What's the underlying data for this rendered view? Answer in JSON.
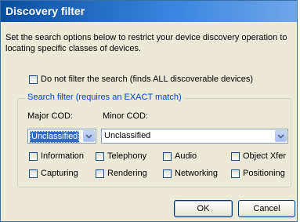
{
  "dialog": {
    "title": "Discovery filter",
    "description": "Set the search options below to restrict your device discovery operation to locating specific classes of devices.",
    "no_filter": {
      "label": "Do not filter the search (finds ALL discoverable devices)",
      "checked": false
    },
    "group_title": "Search filter (requires an EXACT match)",
    "major_cod": {
      "label": "Major COD:",
      "value": "Unclassified"
    },
    "minor_cod": {
      "label": "Minor COD:",
      "value": "Unclassified"
    },
    "services": [
      {
        "label": "Information",
        "checked": false
      },
      {
        "label": "Telephony",
        "checked": false
      },
      {
        "label": "Audio",
        "checked": false
      },
      {
        "label": "Object Xfer",
        "checked": false
      },
      {
        "label": "Capturing",
        "checked": false
      },
      {
        "label": "Rendering",
        "checked": false
      },
      {
        "label": "Networking",
        "checked": false
      },
      {
        "label": "Positioning",
        "checked": false
      }
    ],
    "ok_label": "OK",
    "cancel_label": "Cancel"
  }
}
